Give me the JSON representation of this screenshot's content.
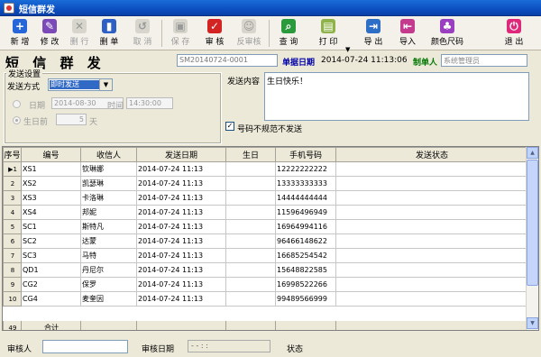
{
  "window": {
    "title": "短信群发"
  },
  "toolbar": {
    "new": "新 增",
    "edit": "修 改",
    "delete_row": "删 行",
    "delete_doc": "删 单",
    "cancel": "取 消",
    "save": "保 存",
    "audit": "审 核",
    "unaudit": "反审核",
    "query": "查 询",
    "print": "打 印",
    "export": "导 出",
    "import": "导入",
    "colors": "颜色尺码",
    "exit": "退 出"
  },
  "header": {
    "title": "短 信 群 发",
    "doc_no": "SM20140724-0001",
    "doc_date_label": "单据日期",
    "doc_date": "2014-07-24 11:13:06",
    "maker_label": "制单人",
    "maker": "系统管理员"
  },
  "settings": {
    "group_title": "发送设置",
    "mode_label": "发送方式",
    "mode_value": "即时发送",
    "date_label": "日期",
    "date_value": "2014-08-30",
    "time_label": "时间",
    "time_value": "14:30:00",
    "birthday_label": "生日前",
    "days_value": "5",
    "days_unit": "天"
  },
  "message": {
    "label": "发送内容",
    "text": "生日快乐！",
    "skip_invalid_label": "号码不规范不发送"
  },
  "table": {
    "columns": [
      "序号",
      "编号",
      "收信人",
      "发送日期",
      "生日",
      "手机号码",
      "发送状态"
    ],
    "rows": [
      {
        "idx": "1",
        "code": "XS1",
        "name": "钦琳娜",
        "date": "2014-07-24 11:13",
        "birthday": "",
        "phone": "12222222222",
        "status": ""
      },
      {
        "idx": "2",
        "code": "XS2",
        "name": "凯瑟琳",
        "date": "2014-07-24 11:13",
        "birthday": "",
        "phone": "13333333333",
        "status": ""
      },
      {
        "idx": "3",
        "code": "XS3",
        "name": "卡洛琳",
        "date": "2014-07-24 11:13",
        "birthday": "",
        "phone": "14444444444",
        "status": ""
      },
      {
        "idx": "4",
        "code": "XS4",
        "name": "邦妮",
        "date": "2014-07-24 11:13",
        "birthday": "",
        "phone": "11596496949",
        "status": ""
      },
      {
        "idx": "5",
        "code": "SC1",
        "name": "斯特凡",
        "date": "2014-07-24 11:13",
        "birthday": "",
        "phone": "16964994116",
        "status": ""
      },
      {
        "idx": "6",
        "code": "SC2",
        "name": "达蒙",
        "date": "2014-07-24 11:13",
        "birthday": "",
        "phone": "96466148622",
        "status": ""
      },
      {
        "idx": "7",
        "code": "SC3",
        "name": "马特",
        "date": "2014-07-24 11:13",
        "birthday": "",
        "phone": "16685254542",
        "status": ""
      },
      {
        "idx": "8",
        "code": "QD1",
        "name": "丹尼尔",
        "date": "2014-07-24 11:13",
        "birthday": "",
        "phone": "15648822585",
        "status": ""
      },
      {
        "idx": "9",
        "code": "CG2",
        "name": "保罗",
        "date": "2014-07-24 11:13",
        "birthday": "",
        "phone": "16998522266",
        "status": ""
      },
      {
        "idx": "10",
        "code": "CG4",
        "name": "麦奎因",
        "date": "2014-07-24 11:13",
        "birthday": "",
        "phone": "99489566999",
        "status": ""
      }
    ],
    "footer_count": "49",
    "footer_label": "合计"
  },
  "bottom": {
    "auditor_label": "审核人",
    "audit_date_label": "审核日期",
    "audit_date_value": "-  -    :  :",
    "status_label": "状态"
  },
  "colors": {
    "titlebar": "#0c4fc0",
    "accent_blue": "#316ac5"
  }
}
